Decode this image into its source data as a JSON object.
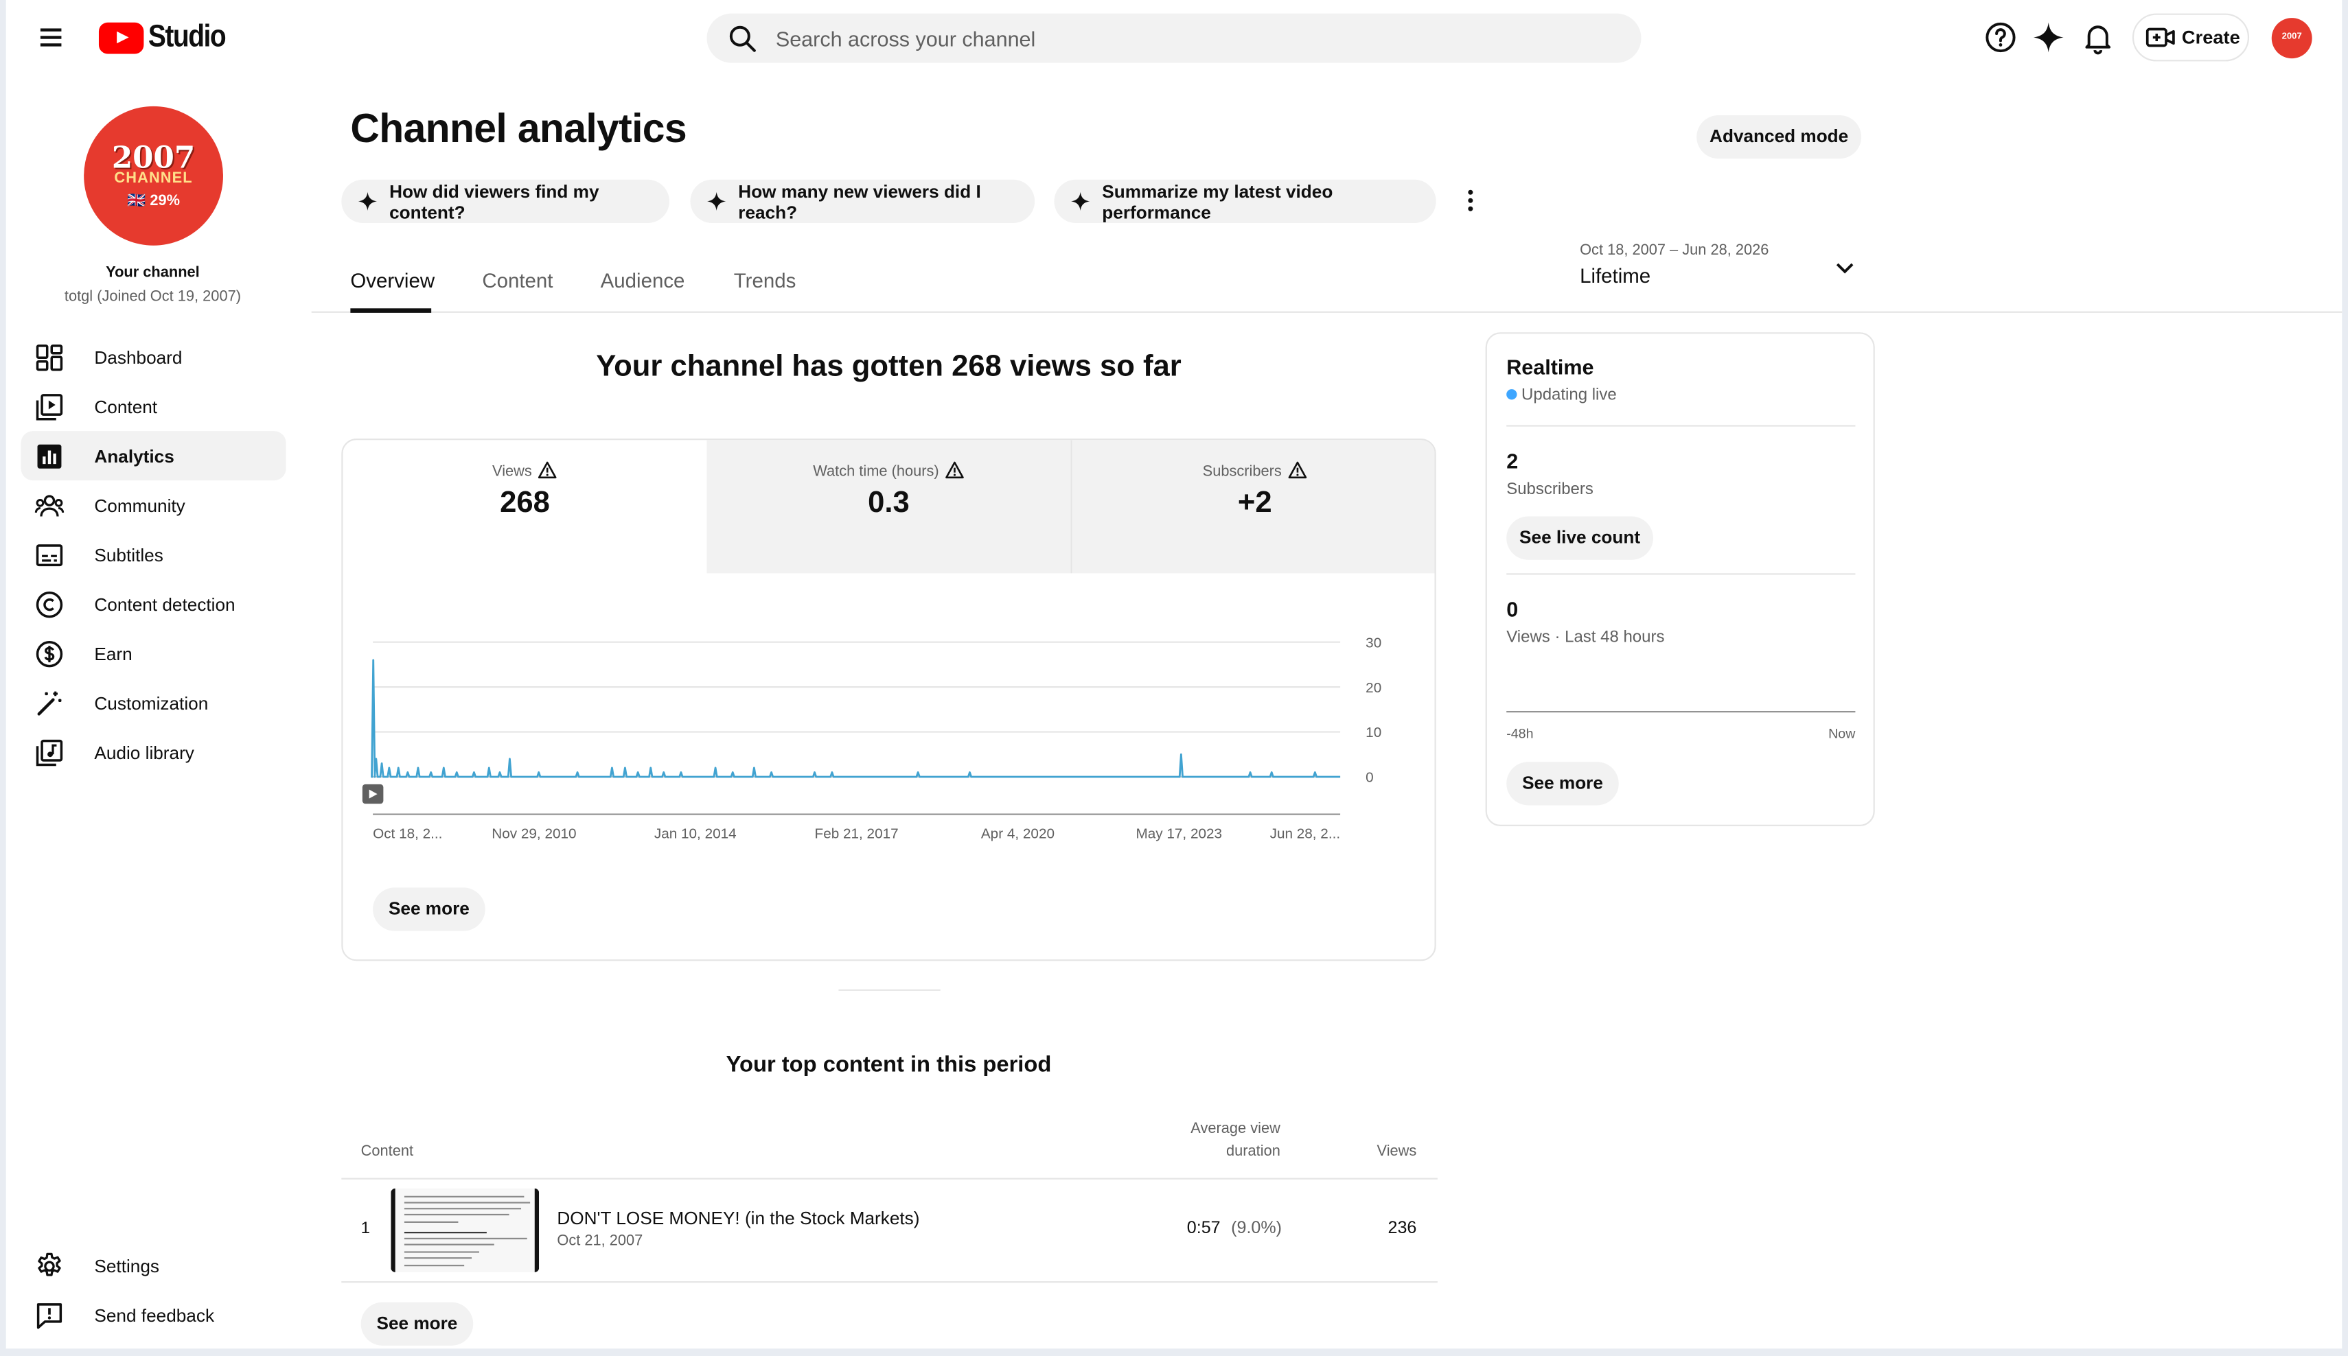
{
  "header": {
    "logo_text": "Studio",
    "search_placeholder": "Search across your channel",
    "create_label": "Create",
    "avatar_text": "2007"
  },
  "sidebar": {
    "avatar": {
      "line1": "2007",
      "line2": "CHANNEL",
      "line3": "🇬🇧 29%"
    },
    "your_channel": "Your channel",
    "channel_sub": "totgl (Joined Oct 19, 2007)",
    "items": [
      {
        "label": "Dashboard",
        "icon": "dashboard-icon"
      },
      {
        "label": "Content",
        "icon": "content-icon"
      },
      {
        "label": "Analytics",
        "icon": "analytics-icon",
        "active": true
      },
      {
        "label": "Community",
        "icon": "community-icon"
      },
      {
        "label": "Subtitles",
        "icon": "subtitles-icon"
      },
      {
        "label": "Content detection",
        "icon": "copyright-icon"
      },
      {
        "label": "Earn",
        "icon": "dollar-icon"
      },
      {
        "label": "Customization",
        "icon": "magic-wand-icon"
      },
      {
        "label": "Audio library",
        "icon": "audio-library-icon"
      }
    ],
    "bottom_items": [
      {
        "label": "Settings",
        "icon": "gear-icon"
      },
      {
        "label": "Send feedback",
        "icon": "feedback-icon"
      }
    ]
  },
  "main": {
    "title": "Channel analytics",
    "advanced_mode": "Advanced mode",
    "chips": [
      "How did viewers find my content?",
      "How many new viewers did I reach?",
      "Summarize my latest video performance"
    ],
    "tabs": [
      "Overview",
      "Content",
      "Audience",
      "Trends"
    ],
    "active_tab": "Overview",
    "date_range": {
      "range": "Oct 18, 2007 – Jun 28, 2026",
      "label": "Lifetime"
    },
    "headline": "Your channel has gotten 268 views so far",
    "metrics": [
      {
        "label": "Views",
        "value": "268",
        "active": true
      },
      {
        "label": "Watch time (hours)",
        "value": "0.3",
        "active": false
      },
      {
        "label": "Subscribers",
        "value": "+2",
        "active": false
      }
    ],
    "chart_see_more": "See more",
    "top_content": {
      "title": "Your top content in this period",
      "col_content": "Content",
      "col_avd_line1": "Average view",
      "col_avd_line2": "duration",
      "col_views": "Views",
      "rows": [
        {
          "rank": "1",
          "title": "DON'T LOSE MONEY! (in the Stock Markets)",
          "date": "Oct 21, 2007",
          "avd": "0:57",
          "avd_pct": "(9.0%)",
          "views": "236"
        }
      ],
      "see_more": "See more"
    }
  },
  "realtime": {
    "title": "Realtime",
    "status": "Updating live",
    "subscribers_value": "2",
    "subscribers_label": "Subscribers",
    "see_live_count": "See live count",
    "views_value": "0",
    "views_label": "Views · Last 48 hours",
    "axis_start": "-48h",
    "axis_end": "Now",
    "see_more": "See more"
  },
  "chart_data": {
    "type": "line",
    "series": [
      {
        "name": "Views",
        "color": "#41a3d1"
      }
    ],
    "x_tick_labels": [
      "Oct 18, 2...",
      "Nov 29, 2010",
      "Jan 10, 2014",
      "Feb 21, 2017",
      "Apr 4, 2020",
      "May 17, 2023",
      "Jun 28, 2..."
    ],
    "y_ticks": [
      0,
      10,
      20,
      30
    ],
    "ylim": [
      0,
      30
    ],
    "x_range": [
      "2007-10-18",
      "2026-06-28"
    ],
    "spikes": [
      {
        "date": "2007-10-21",
        "value": 26
      },
      {
        "date": "2007-11-10",
        "value": 4
      },
      {
        "date": "2007-12-20",
        "value": 3
      },
      {
        "date": "2008-02-10",
        "value": 2
      },
      {
        "date": "2008-04-15",
        "value": 2
      },
      {
        "date": "2008-06-20",
        "value": 1
      },
      {
        "date": "2008-09-01",
        "value": 2
      },
      {
        "date": "2008-12-01",
        "value": 1
      },
      {
        "date": "2009-03-01",
        "value": 2
      },
      {
        "date": "2009-06-01",
        "value": 1
      },
      {
        "date": "2009-10-01",
        "value": 1
      },
      {
        "date": "2010-01-15",
        "value": 2
      },
      {
        "date": "2010-04-01",
        "value": 1
      },
      {
        "date": "2010-06-10",
        "value": 4
      },
      {
        "date": "2011-01-01",
        "value": 1
      },
      {
        "date": "2011-10-01",
        "value": 1
      },
      {
        "date": "2012-06-01",
        "value": 2
      },
      {
        "date": "2012-09-01",
        "value": 2
      },
      {
        "date": "2012-12-01",
        "value": 1
      },
      {
        "date": "2013-03-01",
        "value": 2
      },
      {
        "date": "2013-06-01",
        "value": 1
      },
      {
        "date": "2013-10-01",
        "value": 1
      },
      {
        "date": "2014-06-01",
        "value": 2
      },
      {
        "date": "2014-10-01",
        "value": 1
      },
      {
        "date": "2015-03-01",
        "value": 2
      },
      {
        "date": "2015-07-01",
        "value": 1
      },
      {
        "date": "2016-05-01",
        "value": 1
      },
      {
        "date": "2016-09-01",
        "value": 1
      },
      {
        "date": "2018-05-01",
        "value": 1
      },
      {
        "date": "2019-05-01",
        "value": 1
      },
      {
        "date": "2023-06-01",
        "value": 5
      },
      {
        "date": "2024-10-01",
        "value": 1
      },
      {
        "date": "2025-03-01",
        "value": 1
      },
      {
        "date": "2026-01-01",
        "value": 1
      }
    ]
  }
}
